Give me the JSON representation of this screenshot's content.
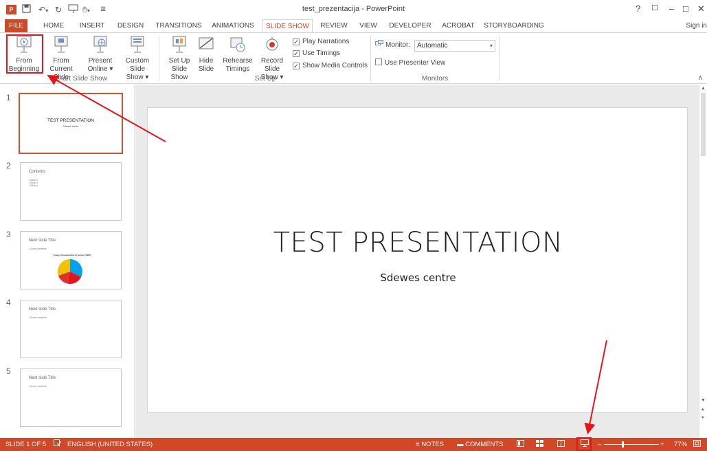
{
  "window": {
    "title": "test_prezentacija - PowerPoint",
    "help": "?",
    "controls": [
      "☐",
      "–",
      "□",
      "✕"
    ]
  },
  "tabs": [
    "FILE",
    "HOME",
    "INSERT",
    "DESIGN",
    "TRANSITIONS",
    "ANIMATIONS",
    "SLIDE SHOW",
    "REVIEW",
    "VIEW",
    "DEVELOPER",
    "ACROBAT",
    "STORYBOARDING"
  ],
  "active_tab": "SLIDE SHOW",
  "sign_in": "Sign in",
  "ribbon": {
    "start_group": {
      "label": "Start Slide Show",
      "from_beginning": [
        "From",
        "Beginning"
      ],
      "from_current": [
        "From",
        "Current Slide"
      ],
      "present_online": [
        "Present",
        "Online ▾"
      ],
      "custom_show": [
        "Custom Slide",
        "Show ▾"
      ]
    },
    "setup_group": {
      "label": "Set Up",
      "set_up": [
        "Set Up",
        "Slide Show"
      ],
      "hide_slide": [
        "Hide",
        "Slide"
      ],
      "rehearse": [
        "Rehearse",
        "Timings"
      ],
      "record": [
        "Record Slide",
        "Show ▾"
      ],
      "play_narrations": "Play Narrations",
      "use_timings": "Use Timings",
      "show_media_controls": "Show Media Controls"
    },
    "monitors_group": {
      "label": "Monitors",
      "monitor_label": "Monitor:",
      "monitor_value": "Automatic",
      "presenter_view": "Use Presenter View"
    }
  },
  "thumbnails": [
    {
      "num": "1",
      "title": "TEST PRESENTATION",
      "subtitle": "Sdewes centre"
    },
    {
      "num": "2",
      "title": "Contents",
      "bullets": [
        "• Slide 2",
        "• Slide 3",
        "• Slide 4"
      ]
    },
    {
      "num": "3",
      "title": "Next slide Title",
      "bullets": [
        "• Some contents"
      ],
      "chart_title": "Energy Consumption by sector (GWh)"
    },
    {
      "num": "4",
      "title": "Next slide Title",
      "bullets": [
        "• Some contents"
      ]
    },
    {
      "num": "5",
      "title": "Next slide Title",
      "bullets": [
        "• Some contents"
      ]
    }
  ],
  "slide": {
    "title": "TEST PRESENTATION",
    "subtitle": "Sdewes centre"
  },
  "statusbar": {
    "slide_info": "SLIDE 1 OF 5",
    "language": "ENGLISH (UNITED STATES)",
    "notes": "NOTES",
    "comments": "COMMENTS",
    "zoom": "77%"
  },
  "colors": {
    "accent": "#d24726",
    "highlight": "#e8141b"
  }
}
